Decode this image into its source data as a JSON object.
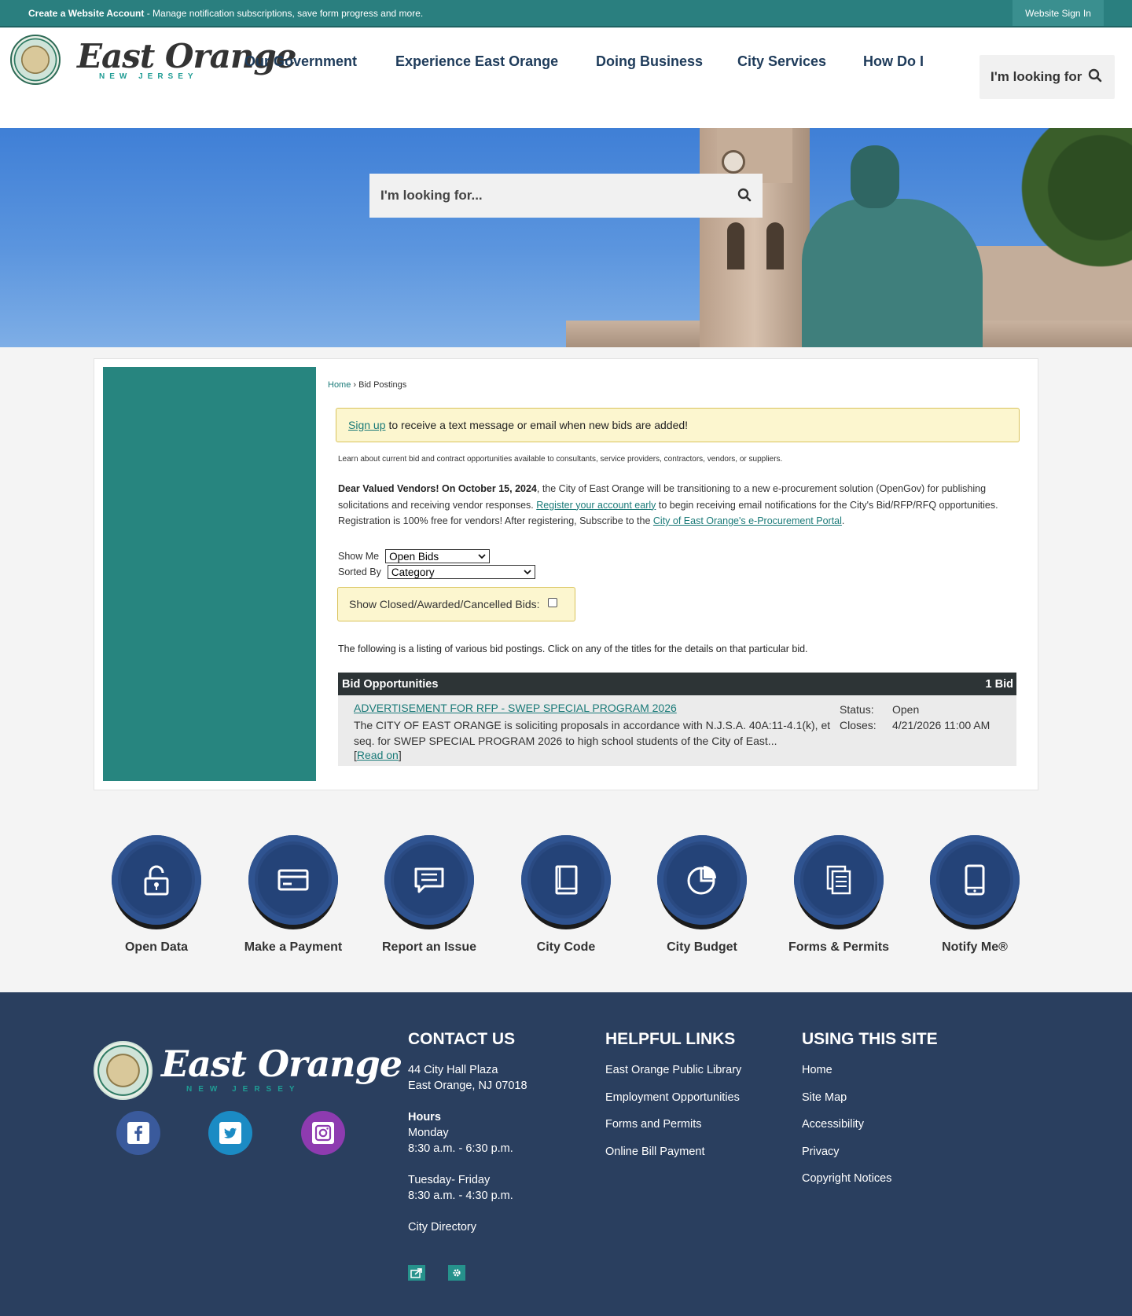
{
  "topbar": {
    "create_bold": "Create a Website Account",
    "create_rest": " - Manage notification subscriptions, save form progress and more.",
    "signin": "Website Sign In"
  },
  "header": {
    "logo_main": "East Orange",
    "logo_sub": "NEW JERSEY",
    "nav": [
      "Our Government",
      "Experience East Orange",
      "Doing Business",
      "City Services",
      "How Do I"
    ],
    "search_label": "I'm looking for"
  },
  "hero": {
    "search_placeholder": "I'm looking for..."
  },
  "breadcrumb": {
    "home": "Home",
    "sep": " › ",
    "current": "Bid Postings"
  },
  "alert": {
    "link": "Sign up",
    "text": "to receive a text message or email when new bids are added!"
  },
  "intro": "Learn about current bid and contract opportunities available to consultants, service providers, contractors, vendors, or suppliers.",
  "vendors": {
    "bold": "Dear Valued Vendors! On October 15, 2024",
    "text1": ", the City of East Orange will be transitioning to a new e-procurement solution (OpenGov) for publishing solicitations and receiving vendor responses. ",
    "link1": "Register your account early",
    "text2": " to begin receiving email notifications for the City's Bid/RFP/RFQ opportunities. Registration is 100% free for vendors! After registering, Subscribe to the ",
    "link2": "City of East Orange's e-Procurement Portal",
    "text3": "."
  },
  "filters": {
    "show_me_label": "Show Me",
    "show_me_value": "Open Bids",
    "sorted_by_label": "Sorted By",
    "sorted_by_value": "Category",
    "closed_label": "Show Closed/Awarded/Cancelled Bids:"
  },
  "listing_text": "The following is a listing of various bid postings. Click on any of the titles for the details on that particular bid.",
  "bids": {
    "header": "Bid Opportunities",
    "count": "1 Bid",
    "items": [
      {
        "title": "ADVERTISEMENT FOR RFP - SWEP SPECIAL PROGRAM 2026",
        "description": "The CITY OF EAST ORANGE is soliciting proposals in accordance with N.J.S.A. 40A:11-4.1(k), et seq. for SWEP SPECIAL PROGRAM 2026 to high school students of the City of East...",
        "read_on": "Read on",
        "status_label": "Status:",
        "status": "Open",
        "closes_label": "Closes:",
        "closes": "4/21/2026 11:00 AM"
      }
    ]
  },
  "quick_links": [
    {
      "label": "Open Data",
      "icon": "lock-open-icon"
    },
    {
      "label": "Make a Payment",
      "icon": "credit-card-icon"
    },
    {
      "label": "Report an Issue",
      "icon": "chat-icon"
    },
    {
      "label": "City Code",
      "icon": "book-icon"
    },
    {
      "label": "City Budget",
      "icon": "pie-chart-icon"
    },
    {
      "label": "Forms & Permits",
      "icon": "documents-icon"
    },
    {
      "label": "Notify Me®",
      "icon": "phone-icon"
    }
  ],
  "footer": {
    "logo_main": "East Orange",
    "logo_sub": "NEW JERSEY",
    "contact_title": "CONTACT US",
    "address1": "44 City Hall Plaza",
    "address2": "East Orange, NJ 07018",
    "hours_title": "Hours",
    "hours_day1": "Monday",
    "hours_time1": "8:30 a.m. - 6:30 p.m.",
    "hours_day2": "Tuesday- Friday",
    "hours_time2": "8:30 a.m. - 4:30 p.m.",
    "directory": "City Directory",
    "helpful_title": "HELPFUL LINKS",
    "helpful": [
      "East Orange Public Library",
      "Employment Opportunities",
      "Forms and Permits",
      "Online Bill Payment"
    ],
    "using_title": "USING THIS SITE",
    "using": [
      "Home",
      "Site Map",
      "Accessibility",
      "Privacy",
      "Copyright Notices"
    ]
  },
  "colors": {
    "teal": "#2a7f7f",
    "navy": "#2a3f5f",
    "button_blue": "#2a4a82",
    "alert_bg": "#fcf6cf"
  }
}
